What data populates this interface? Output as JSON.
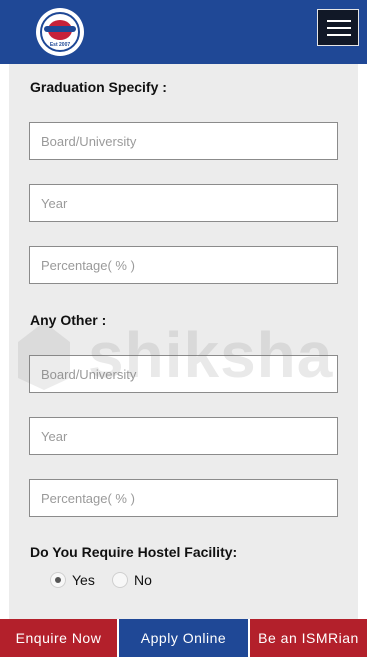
{
  "header": {
    "logo_text": "Est 2007",
    "menu_icon": "hamburger-menu-icon",
    "brand_color": "#1f4896"
  },
  "form": {
    "graduation_label": "Graduation Specify :",
    "graduation_fields": [
      {
        "placeholder": "Board/University",
        "value": ""
      },
      {
        "placeholder": "Year",
        "value": ""
      },
      {
        "placeholder": "Percentage( % )",
        "value": ""
      }
    ],
    "other_label": "Any Other :",
    "other_fields": [
      {
        "placeholder": "Board/University",
        "value": ""
      },
      {
        "placeholder": "Year",
        "value": ""
      },
      {
        "placeholder": "Percentage( % )",
        "value": ""
      }
    ],
    "hostel_label": "Do You Require Hostel Facility:",
    "hostel_options": [
      {
        "label": "Yes",
        "checked": true
      },
      {
        "label": "No",
        "checked": false
      }
    ]
  },
  "watermark": {
    "text": "shiksha"
  },
  "bottom_bar": {
    "enquire_label": "Enquire Now",
    "apply_label": "Apply Online",
    "ismr_label": "Be an ISMRian",
    "accent_red": "#b3202b",
    "accent_blue": "#1f4896"
  }
}
